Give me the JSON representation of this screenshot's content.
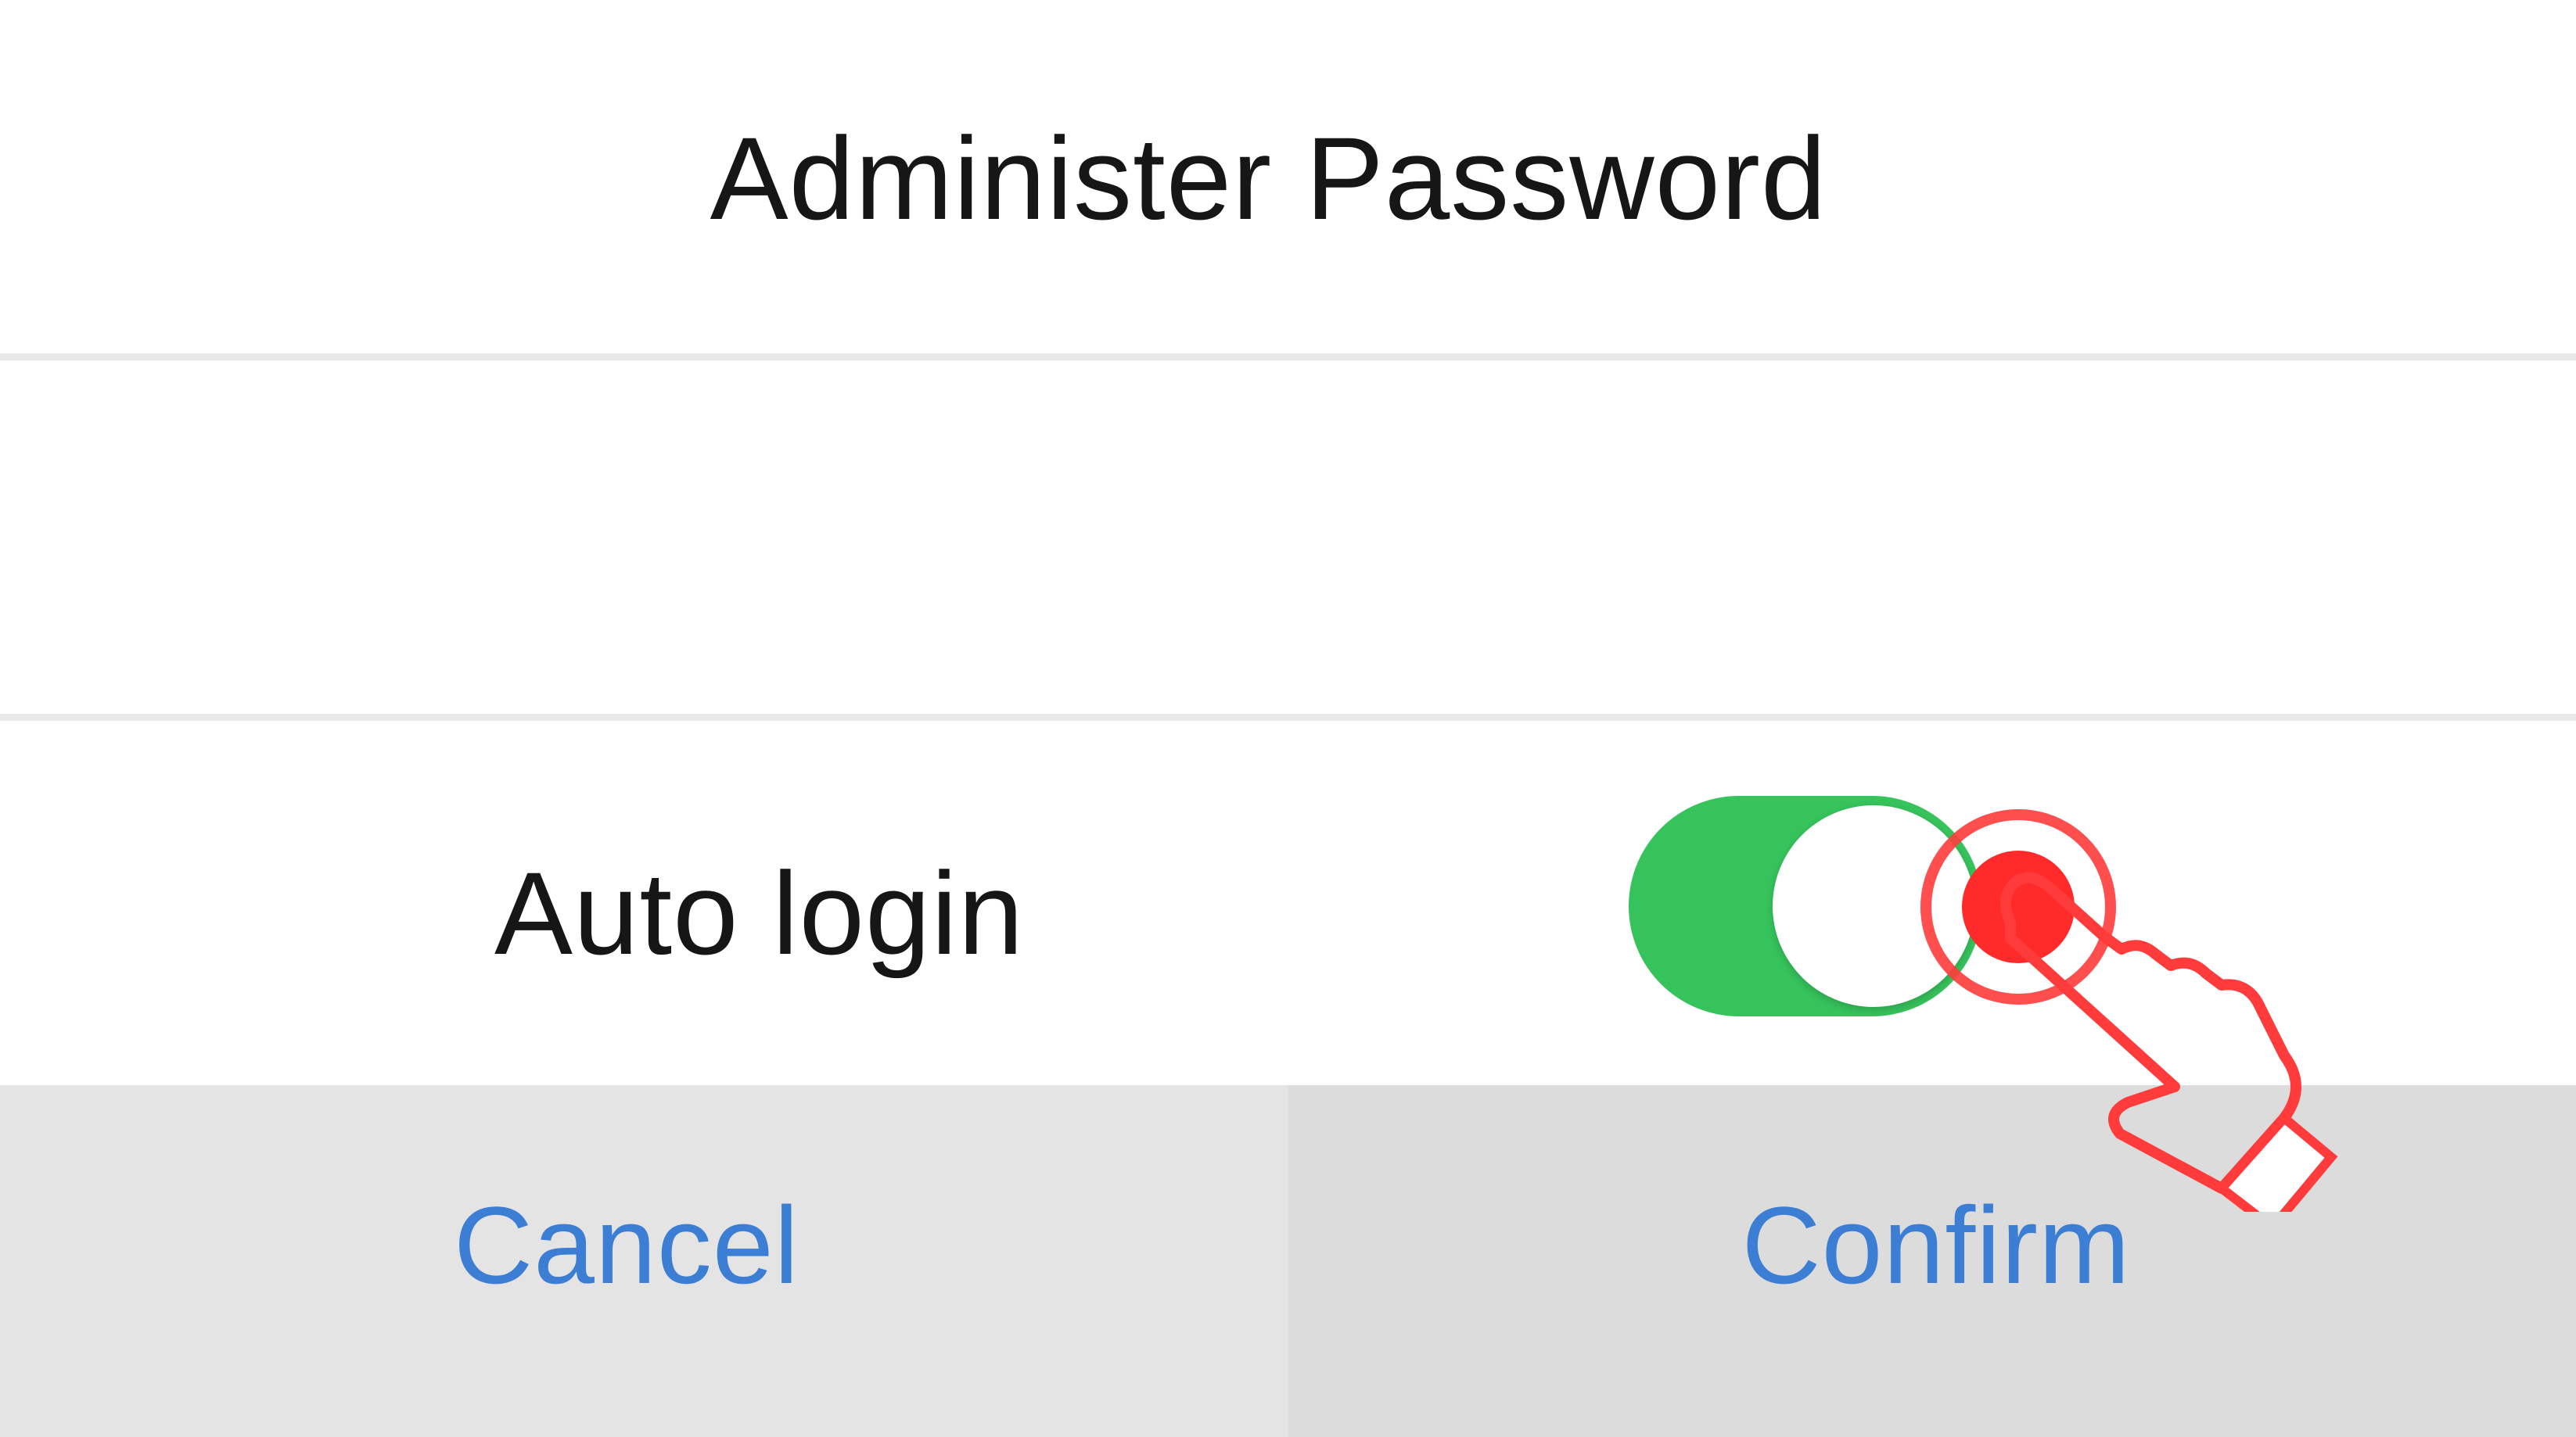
{
  "dialog": {
    "title": "Administer Password",
    "password_field": {
      "value": "",
      "placeholder": ""
    },
    "auto_login": {
      "label": "Auto login",
      "enabled": true
    },
    "buttons": {
      "cancel_label": "Cancel",
      "confirm_label": "Confirm"
    }
  },
  "icons": {
    "toggle": "toggle-switch-icon",
    "tap_hint": "tap-hand-icon"
  },
  "colors": {
    "toggle_on": "#36c35c",
    "button_text": "#3c7ed3",
    "tap_hint": "#ff3b3b"
  }
}
